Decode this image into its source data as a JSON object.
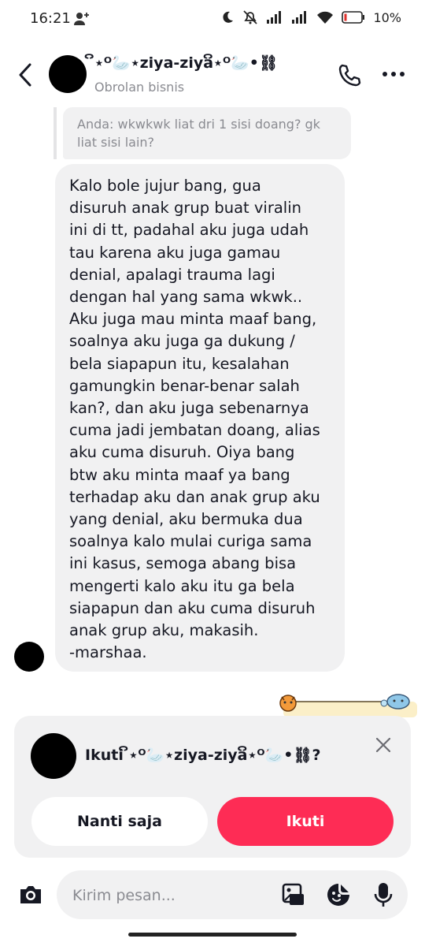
{
  "status_bar": {
    "time": "16:21",
    "battery_percent": "10%",
    "icons": [
      "person-add-icon",
      "moon-icon",
      "mute-icon",
      "signal-icon",
      "signal-icon",
      "wifi-icon",
      "battery-icon"
    ]
  },
  "header": {
    "title": "ິ⋆ᴼ🦢⋆ziya-ziyaິ⋆ᴼ🦢•⛓",
    "subtitle": "Obrolan bisnis"
  },
  "chat": {
    "quoted_message": "Anda: wkwkwk liat dri 1 sisi doang? gk liat sisi lain?",
    "message": "Kalo bole jujur bang, gua\ndisuruh anak grup buat viralin\nini di tt, padahal aku juga udah\ntau karena aku juga gamau\ndenial, apalagi trauma lagi\ndengan hal yang sama wkwk..\nAku juga mau minta maaf bang,\nsoalnya aku juga ga dukung /\nbela siapapun itu, kesalahan\ngamungkin benar-benar salah\nkan?, dan aku juga sebenarnya\ncuma jadi jembatan doang, alias\naku cuma disuruh. Oiya bang\nbtw aku minta maaf ya bang\nterhadap aku dan anak grup aku\nyang denial, aku bermuka dua\nsoalnya kalo mulai curiga sama\nini kasus, semoga abang bisa\nmengerti kalo aku itu ga bela\nsiapapun dan aku cuma disuruh\nanak grup aku, makasih.\n-marshaa."
  },
  "follow_card": {
    "title": "Ikuti ິ⋆ᴼ🦢⋆ziya-ziyaິ⋆ᴼ🦢•⛓?",
    "later_label": "Nanti saja",
    "follow_label": "Ikuti"
  },
  "composer": {
    "placeholder": "Kirim pesan..."
  },
  "colors": {
    "accent": "#fe2c55",
    "bubble": "#f1f1f2",
    "muted_text": "#8a8b91"
  }
}
